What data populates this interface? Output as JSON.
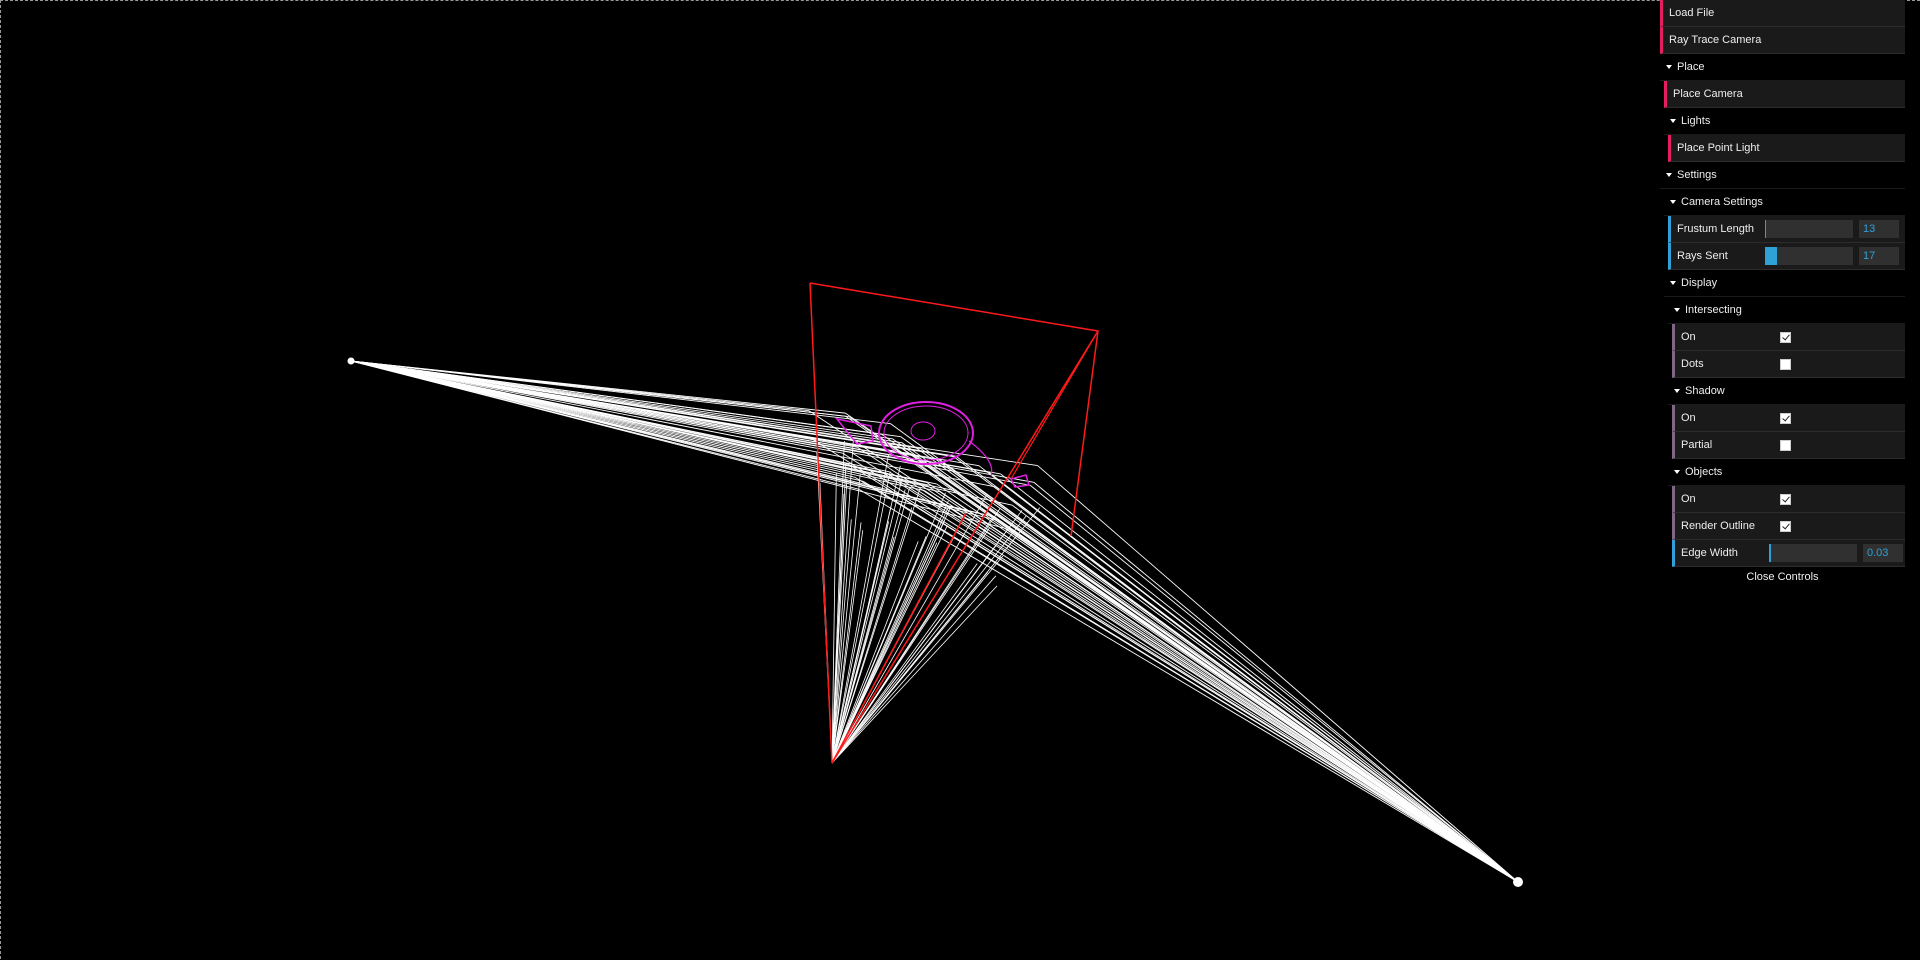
{
  "gui": {
    "load_file": "Load File",
    "ray_trace_camera": "Ray Trace Camera",
    "place": {
      "title": "Place",
      "place_camera": "Place Camera"
    },
    "lights": {
      "title": "Lights",
      "place_point_light": "Place Point Light"
    },
    "settings": {
      "title": "Settings",
      "camera_settings": {
        "title": "Camera Settings",
        "frustum_length": {
          "label": "Frustum Length",
          "value": "13",
          "fill": 0.01
        },
        "rays_sent": {
          "label": "Rays Sent",
          "value": "17",
          "fill": 0.14
        }
      },
      "display": {
        "title": "Display",
        "intersecting": {
          "title": "Intersecting",
          "on": {
            "label": "On",
            "checked": true
          },
          "dots": {
            "label": "Dots",
            "checked": false
          }
        },
        "shadow": {
          "title": "Shadow",
          "on": {
            "label": "On",
            "checked": true
          },
          "partial": {
            "label": "Partial",
            "checked": false
          }
        },
        "objects": {
          "title": "Objects",
          "on": {
            "label": "On",
            "checked": true
          },
          "render_outline": {
            "label": "Render Outline",
            "checked": true
          },
          "edge_width": {
            "label": "Edge Width",
            "value": "0.03",
            "fill": 0.02
          }
        }
      }
    },
    "close_controls": "Close Controls"
  },
  "colors": {
    "background": "#000000",
    "frustum": "#ff1a1a",
    "rays": "#ffffff",
    "object_outline": "#e020e0",
    "button_accent": "#e61d5f",
    "number_accent": "#2fa1d6",
    "boolean_accent": "#806787"
  }
}
